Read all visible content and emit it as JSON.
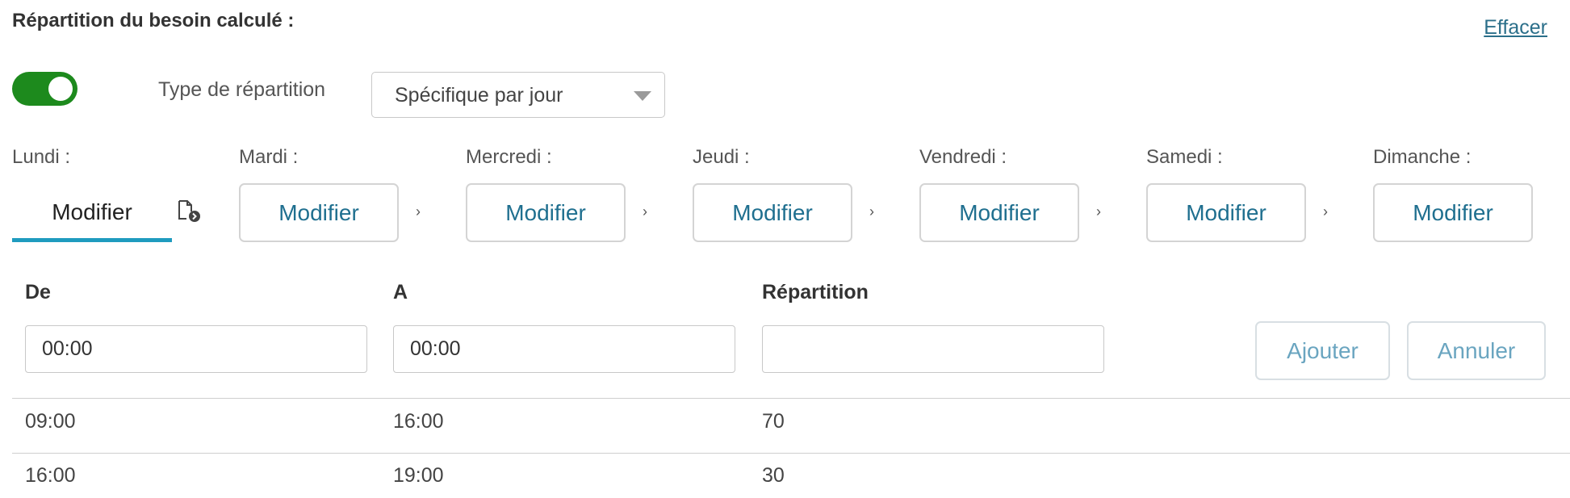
{
  "header": {
    "title": "Répartition du besoin calculé :",
    "clear_link": "Effacer"
  },
  "controls": {
    "toggle_on": true,
    "type_label": "Type de répartition",
    "type_select_value": "Spécifique par jour"
  },
  "days": [
    {
      "label": "Lundi :",
      "button": "Modifier",
      "active": true
    },
    {
      "label": "Mardi :",
      "button": "Modifier"
    },
    {
      "label": "Mercredi :",
      "button": "Modifier"
    },
    {
      "label": "Jeudi :",
      "button": "Modifier"
    },
    {
      "label": "Vendredi :",
      "button": "Modifier"
    },
    {
      "label": "Samedi :",
      "button": "Modifier"
    },
    {
      "label": "Dimanche :",
      "button": "Modifier"
    }
  ],
  "form": {
    "columns": {
      "from": "De",
      "to": "A",
      "split": "Répartition"
    },
    "from_value": "00:00",
    "to_value": "00:00",
    "split_value": "",
    "add_button": "Ajouter",
    "cancel_button": "Annuler"
  },
  "rows": [
    {
      "from": "09:00",
      "to": "16:00",
      "split": "70"
    },
    {
      "from": "16:00",
      "to": "19:00",
      "split": "30"
    }
  ],
  "colors": {
    "toggle_on": "#1d8a1d",
    "accent": "#1f6f8f",
    "active_underline": "#1f9bbf"
  }
}
